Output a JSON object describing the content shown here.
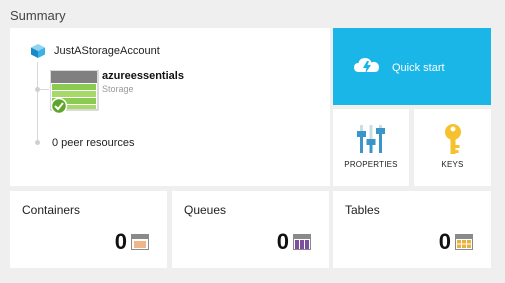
{
  "page": {
    "title": "Summary"
  },
  "resource": {
    "account_name": "JustAStorageAccount",
    "storage_name": "azureessentials",
    "storage_type": "Storage",
    "peer_resources": "0 peer resources"
  },
  "quickstart": {
    "label": "Quick start",
    "color": "#1ab6e8"
  },
  "properties": {
    "label": "PROPERTIES",
    "icon": "sliders-icon"
  },
  "keys": {
    "label": "KEYS",
    "icon": "key-icon"
  },
  "containers": {
    "label": "Containers",
    "count": "0",
    "icon": "container-icon"
  },
  "queues": {
    "label": "Queues",
    "count": "0",
    "icon": "queue-icon"
  },
  "tables": {
    "label": "Tables",
    "count": "0",
    "icon": "table-icon"
  }
}
